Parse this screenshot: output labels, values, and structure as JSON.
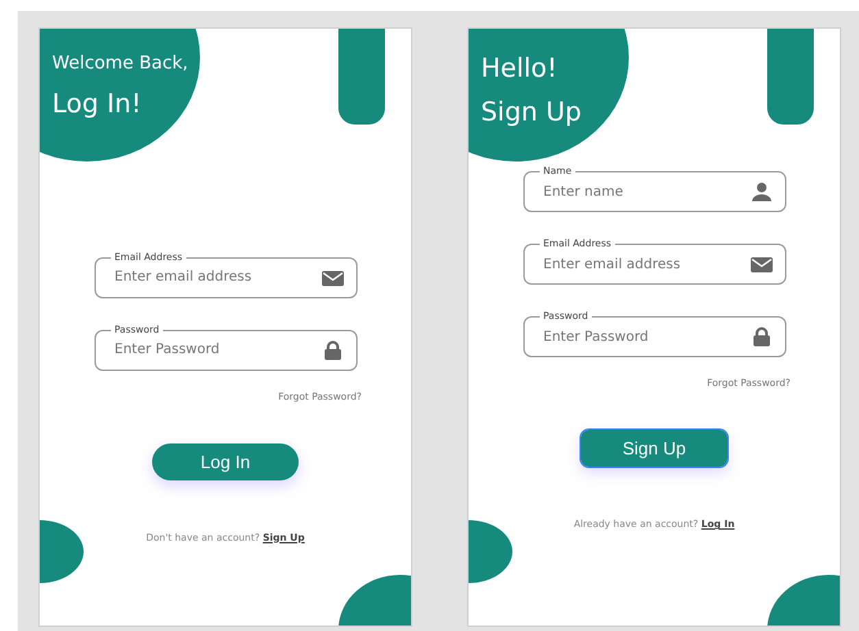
{
  "screens": [
    {
      "heading": [
        {
          "text": "Welcome Back,",
          "kind": "small"
        },
        {
          "text": "Log In!",
          "kind": "large"
        }
      ],
      "fields": [
        {
          "kind": "email",
          "label": "Email Address",
          "placeholder": "Enter email address"
        },
        {
          "kind": "password",
          "label": "Password",
          "placeholder": "Enter Password"
        }
      ],
      "forgot_link": "Forgot Password?",
      "button": {
        "label": "Log In",
        "focused": false
      },
      "footer": {
        "text": "Don't have an account?",
        "link": "Sign Up"
      }
    },
    {
      "heading": [
        {
          "text": "Hello!",
          "kind": "large"
        },
        {
          "text": "Sign Up",
          "kind": "large"
        }
      ],
      "fields": [
        {
          "kind": "name",
          "label": "Name",
          "placeholder": "Enter name"
        },
        {
          "kind": "email",
          "label": "Email Address",
          "placeholder": "Enter email address"
        },
        {
          "kind": "password",
          "label": "Password",
          "placeholder": "Enter Password"
        }
      ],
      "forgot_link": "Forgot Password?",
      "button": {
        "label": "Sign Up",
        "focused": true
      },
      "footer": {
        "text": "Already have an account?",
        "link": "Log In"
      }
    }
  ]
}
